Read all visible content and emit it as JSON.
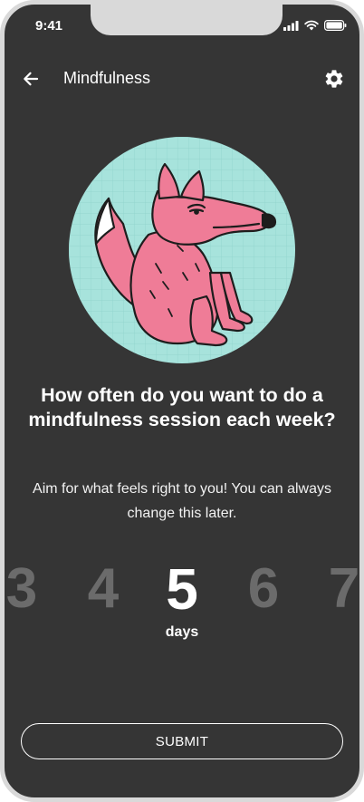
{
  "status_bar": {
    "time": "9:41",
    "icons": [
      "signal-icon",
      "wifi-icon",
      "battery-icon"
    ]
  },
  "app_bar": {
    "back_icon": "arrow-left-icon",
    "title": "Mindfulness",
    "settings_icon": "gear-icon"
  },
  "illustration": {
    "subject": "pink-fox-illustration",
    "background_color": "#a7e3dc",
    "fox_color": "#ef7c97"
  },
  "question": {
    "headline": "How often do you want to do a mindfulness session each week?",
    "subtext": "Aim for what feels right to you! You can always change this later."
  },
  "picker": {
    "options": [
      "3",
      "4",
      "5",
      "6",
      "7"
    ],
    "selected_value": "5",
    "unit_label": "days"
  },
  "submit": {
    "label": "SUBMIT"
  },
  "colors": {
    "background": "#353535",
    "frame": "#d9d9d9",
    "text": "#ffffff",
    "unselected_number": "#6b6b6b"
  }
}
